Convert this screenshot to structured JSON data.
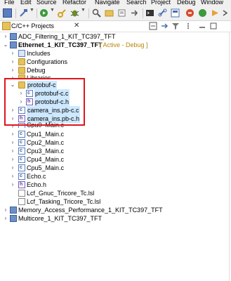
{
  "menubar": {
    "items": [
      "File",
      "Edit",
      "Source",
      "Refactor",
      "Navigate",
      "Search",
      "Project",
      "Debug",
      "Window"
    ]
  },
  "toolbar": {
    "icons": [
      "save-icon",
      "build-hammer-icon",
      "run-icon",
      "key-icon",
      "debug-icon",
      "search-icon",
      "stop-icon",
      "go-icon",
      "nav-icon"
    ]
  },
  "view": {
    "title": "C/C++ Projects",
    "close": "✕"
  },
  "tree": {
    "chevron_collapsed": "›",
    "chevron_expanded": "⌄",
    "projects": {
      "adc": "ADC_Filtering_1_KIT_TC397_TFT",
      "ethernet": "Ethernet_1_KIT_TC397_TFT",
      "ethernet_status": "[ Active - Debug ]",
      "memory": "Memory_Access_Performance_1_KIT_TC397_TFT",
      "multicore": "Multicore_1_KIT_TC397_TFT"
    },
    "children": {
      "includes": "Includes",
      "configurations": "Configurations",
      "debug": "Debug",
      "libraries": "Libraries",
      "protobuf_folder": "protobuf-c",
      "protobuf_c": "protobuf-c.c",
      "protobuf_h": "protobuf-c.h",
      "camera_c": "camera_ins.pb-c.c",
      "camera_h": "camera_ins.pb-c.h",
      "cpu0": "Cpu0_Main.c",
      "cpu1": "Cpu1_Main.c",
      "cpu2": "Cpu2_Main.c",
      "cpu3": "Cpu3_Main.c",
      "cpu4": "Cpu4_Main.c",
      "cpu5": "Cpu5_Main.c",
      "echo_c": "Echo.c",
      "echo_h": "Echo.h",
      "lcf_gnuc": "Lcf_Gnuc_Tricore_Tc.lsl",
      "lcf_tasking": "Lcf_Tasking_Tricore_Tc.lsl"
    },
    "file_letters": {
      "c": "c",
      "h": "h"
    }
  },
  "colors": {
    "highlight_box": "#e0141e",
    "active_status": "#b8860b",
    "selection": "#cce4f7"
  }
}
